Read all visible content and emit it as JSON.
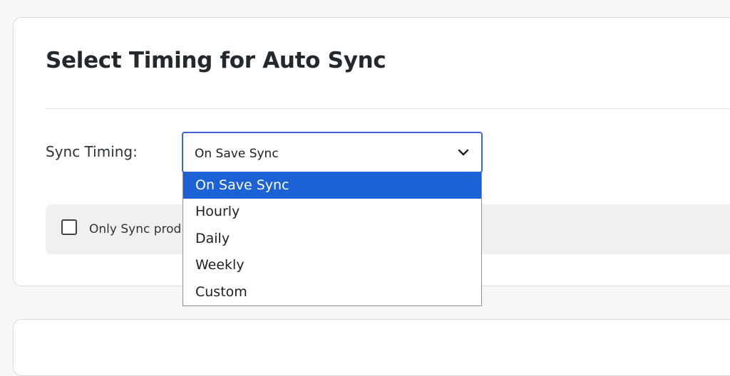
{
  "card": {
    "title": "Select Timing for Auto Sync"
  },
  "sync_timing": {
    "label": "Sync Timing:",
    "selected_value": "On Save Sync",
    "options": [
      "On Save Sync",
      "Hourly",
      "Daily",
      "Weekly",
      "Custom"
    ],
    "selected_index": 0
  },
  "sync_option": {
    "label": "Only Sync prod",
    "checked": false
  },
  "colors": {
    "focus_border": "#3c63e0",
    "selected_option_bg": "#1a62d6",
    "option_row_bg": "#f0f0f0"
  }
}
